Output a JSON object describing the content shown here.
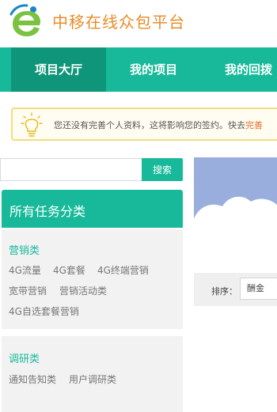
{
  "header": {
    "site_title": "中移在线众包平台",
    "logo_icon": "e-logo-icon"
  },
  "nav": {
    "items": [
      {
        "label": "项目大厅",
        "active": true
      },
      {
        "label": "我的项目",
        "active": false
      },
      {
        "label": "我的回拨",
        "active": false
      }
    ]
  },
  "notice": {
    "icon": "lightbulb-icon",
    "text": "您还没有完善个人资料，这将影响您的签约。快去",
    "link": "完善"
  },
  "search": {
    "placeholder": "",
    "button_label": "搜索"
  },
  "sidebar": {
    "title": "所有任务分类",
    "groups": [
      {
        "title": "营销类",
        "items": [
          "4G流量",
          "4G套餐",
          "4G终端营销",
          "宽带营销",
          "营销活动类",
          "4G自选套餐营销"
        ]
      },
      {
        "title": "调研类",
        "items": [
          "通知告知类",
          "用户调研类"
        ]
      }
    ]
  },
  "sort": {
    "label": "排序：",
    "selected": "酬金"
  },
  "colors": {
    "brand_green": "#17b99a",
    "nav_active": "#0f9579",
    "logo_orange": "#e98b2a",
    "notice_border": "#f3dc7e"
  }
}
